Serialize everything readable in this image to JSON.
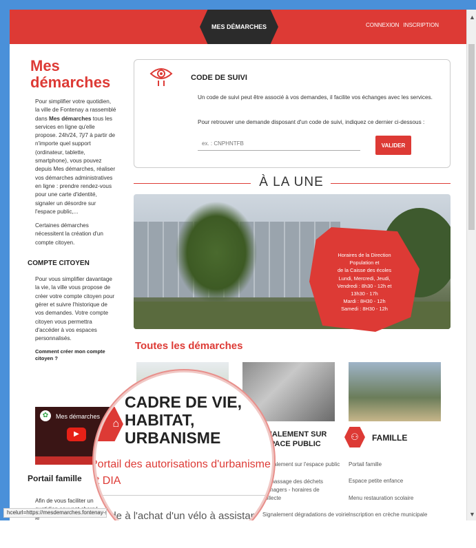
{
  "header": {
    "center_tab": "MES DÉMARCHES",
    "links": [
      "CONNEXION",
      "INSCRIPTION"
    ]
  },
  "sidebar": {
    "title": "Mes démarches",
    "intro_before": "Pour simplifier votre quotidien, la ville de Fontenay a rassemblé dans ",
    "intro_bold": "Mes démarches",
    "intro_after": " tous les services en ligne qu'elle propose. 24h/24, 7j/7 à partir de n'importe quel support (ordinateur, tablette, smartphone), vous pouvez depuis Mes démarches, réaliser vos démarches administratives en ligne : prendre rendez-vous pour une carte d'identité, signaler un désordre sur l'espace public,...",
    "note": "Certaines démarches nécessitent la création d'un compte citoyen.",
    "compte_title": "COMPTE CITOYEN",
    "compte_text": "Pour vous simplifier davantage la vie, la ville vous propose de créer votre compte citoyen pour gérer et suivre l'historique de vos demandes. Votre compte citoyen vous permettra d'accéder à vos espaces personnalisés.",
    "compte_link": "Comment créer mon compte citoyen ?",
    "video_title": "Mes démarches",
    "portail_title": "Portail famille",
    "portail_text": "Afin de vous faciliter un quotidien souvent chargé, le"
  },
  "code_suivi": {
    "title": "CODE DE SUIVI",
    "desc": "Un code de suivi peut être associé à vos demandes, il facilite vos échanges avec les services.",
    "desc2": "Pour retrouver une demande disposant d'un code de suivi, indiquez ce dernier ci-dessous :",
    "placeholder": "ex. : CNPHNTFB",
    "button": "VALIDER"
  },
  "une": {
    "title": "À LA UNE",
    "hours_lines": [
      "Horaires de la Direction",
      "Population et",
      "de la Caisse des écoles",
      "Lundi, Mercredi, Jeudi,",
      "Vendredi : 8h30 - 12h et",
      "13h30 - 17h",
      "Mardi : 8H30 - 12h",
      "Samedi : 8H30 - 12h"
    ]
  },
  "toutes": {
    "title": "Toutes les démarches",
    "signalement": "SIGNALEMENT SUR L'ESPACE PUBLIC",
    "signalement_links": [
      "Signalement sur l'espace public",
      "Ramassage des déchets ménagers - horaires de collecte",
      "Signalement dégradations de voirie"
    ],
    "famille": "FAMILLE",
    "famille_links": [
      "Portail famille",
      "Espace petite enfance",
      "Menu restauration scolaire",
      "Inscription en crèche municipale"
    ]
  },
  "magnifier": {
    "title": "CADRE DE VIE, HABITAT, URBANISME",
    "link": "Portail des autorisations d'urbanisme et DIA",
    "link2": "Aide à l'achat d'un vélo à assistance"
  },
  "status_url": "hcelurl=https://mesdemarches.fontenay-sous-bois.fr"
}
